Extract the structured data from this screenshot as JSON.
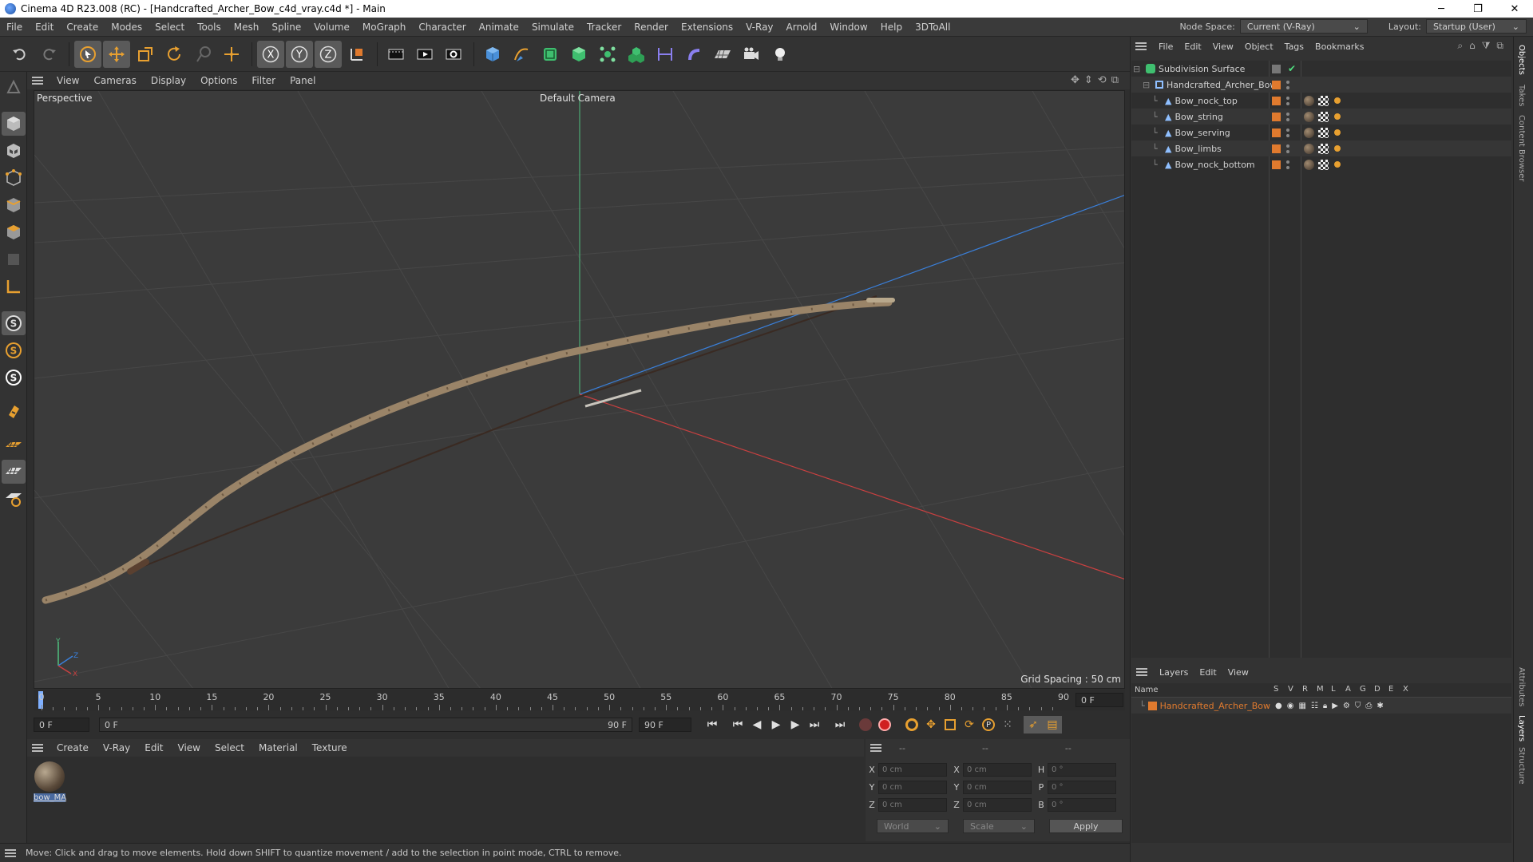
{
  "window": {
    "title": "Cinema 4D R23.008 (RC) - [Handcrafted_Archer_Bow_c4d_vray.c4d *] - Main",
    "controls": [
      "─",
      "❐",
      "✕"
    ]
  },
  "menubar": {
    "items": [
      "File",
      "Edit",
      "Create",
      "Modes",
      "Select",
      "Tools",
      "Mesh",
      "Spline",
      "Volume",
      "MoGraph",
      "Character",
      "Animate",
      "Simulate",
      "Tracker",
      "Render",
      "Extensions",
      "V-Ray",
      "Arnold",
      "Window",
      "Help",
      "3DToAll"
    ],
    "node_space_label": "Node Space:",
    "node_space_value": "Current (V-Ray)",
    "layout_label": "Layout:",
    "layout_value": "Startup (User)"
  },
  "toolbar": {
    "icons": [
      "undo-icon",
      "redo-icon",
      "select-icon",
      "move-icon",
      "scale-icon",
      "rotate-icon",
      "live-select-icon",
      "transform-icon",
      "x-axis-icon",
      "y-axis-icon",
      "z-axis-icon",
      "coordinate-icon",
      "render-region-icon",
      "render-view-icon",
      "render-settings-icon",
      "cube-icon",
      "pen-icon",
      "subdivision-icon",
      "extrude-icon",
      "cloner-icon",
      "array-icon",
      "deformer-icon",
      "field-icon",
      "floor-icon",
      "camera-icon",
      "light-icon"
    ],
    "axis_letters": [
      "X",
      "Y",
      "Z"
    ]
  },
  "viewport": {
    "menu": [
      "View",
      "Cameras",
      "Display",
      "Options",
      "Filter",
      "Panel"
    ],
    "view_name": "Perspective",
    "camera_name": "Default Camera",
    "grid_spacing": "Grid Spacing : 50 cm",
    "axis_labels": {
      "y": "Y",
      "z": "Z",
      "x": "X"
    }
  },
  "timeline": {
    "ticks": [
      "0",
      "5",
      "10",
      "15",
      "20",
      "25",
      "30",
      "35",
      "40",
      "45",
      "50",
      "55",
      "60",
      "65",
      "70",
      "75",
      "80",
      "85",
      "90"
    ],
    "current_frame": "0 F",
    "start_frame": "0 F",
    "range_start": "0 F",
    "range_end": "90 F",
    "end_frame": "90 F"
  },
  "material_manager": {
    "menu": [
      "Create",
      "V-Ray",
      "Edit",
      "View",
      "Select",
      "Material",
      "Texture"
    ],
    "materials": [
      {
        "name": "bow_MA"
      }
    ]
  },
  "coordinates": {
    "header": [
      "--",
      "--",
      "--"
    ],
    "rows": [
      {
        "a": "X",
        "av": "0 cm",
        "b": "X",
        "bv": "0 cm",
        "c": "H",
        "cv": "0 °"
      },
      {
        "a": "Y",
        "av": "0 cm",
        "b": "Y",
        "bv": "0 cm",
        "c": "P",
        "cv": "0 °"
      },
      {
        "a": "Z",
        "av": "0 cm",
        "b": "Z",
        "bv": "0 cm",
        "c": "B",
        "cv": "0 °"
      }
    ],
    "space": "World",
    "mode": "Scale",
    "apply_label": "Apply"
  },
  "status": {
    "text": "Move: Click and drag to move elements. Hold down SHIFT to quantize movement / add to the selection in point mode, CTRL to remove."
  },
  "object_manager": {
    "menu": [
      "File",
      "Edit",
      "View",
      "Object",
      "Tags",
      "Bookmarks"
    ],
    "objects": [
      {
        "name": "Subdivision Surface",
        "level": 0
      },
      {
        "name": "Handcrafted_Archer_Bow",
        "level": 1
      },
      {
        "name": "Bow_nock_top",
        "level": 2
      },
      {
        "name": "Bow_string",
        "level": 2
      },
      {
        "name": "Bow_serving",
        "level": 2
      },
      {
        "name": "Bow_limbs",
        "level": 2
      },
      {
        "name": "Bow_nock_bottom",
        "level": 2
      }
    ]
  },
  "layer_manager": {
    "menu": [
      "Layers",
      "Edit",
      "View"
    ],
    "name_header": "Name",
    "flags": [
      "S",
      "V",
      "R",
      "M",
      "L",
      "A",
      "G",
      "D",
      "E",
      "X"
    ],
    "layers": [
      {
        "name": "Handcrafted_Archer_Bow",
        "color": "#e07a2e"
      }
    ]
  },
  "side_tabs": [
    "Objects",
    "Takes",
    "Content Browser",
    "Attributes",
    "Layers",
    "Structure"
  ]
}
